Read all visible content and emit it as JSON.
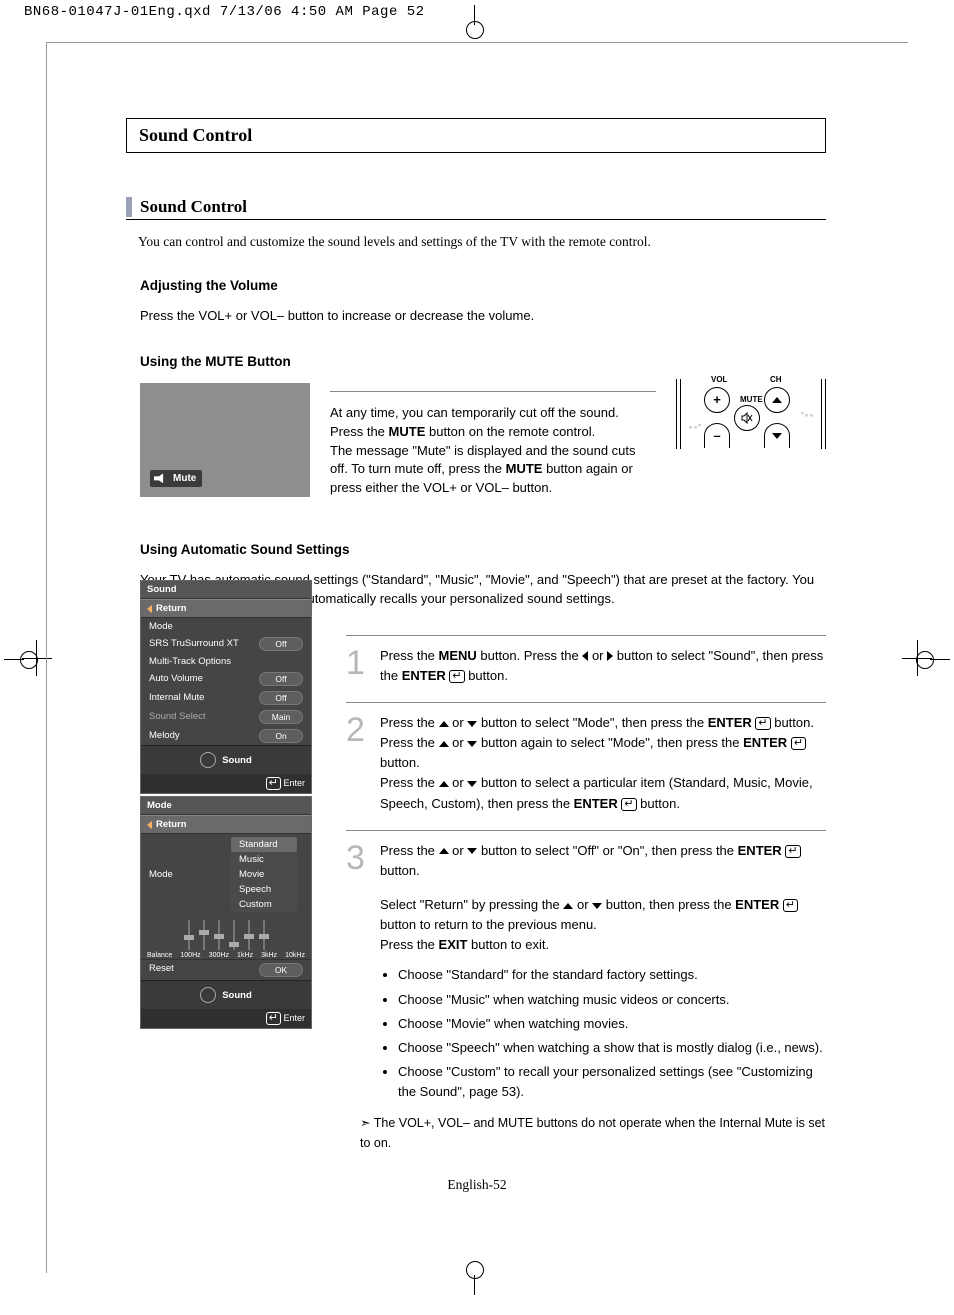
{
  "file_header": "BN68-01047J-01Eng.qxd  7/13/06  4:50 AM  Page 52",
  "chapter_title": "Sound Control",
  "section_title": "Sound Control",
  "intro": "You can control and customize the sound levels and settings of the TV with the remote control.",
  "sub1": "Adjusting the Volume",
  "sub1_body": "Press the VOL+ or VOL– button to increase or decrease the volume.",
  "sub2": "Using the MUTE Button",
  "osd_mute_label": "Mute",
  "mute_para_1": "At any time, you can temporarily cut off the sound.",
  "mute_para_2a": "Press the ",
  "mute_bold_MUTE": "MUTE",
  "mute_para_2b": " button on the remote control.",
  "mute_para_3": "The message \"Mute\" is displayed and the sound cuts off. To turn mute off, press the ",
  "mute_para_3b": " button again or press either the VOL+ or VOL– button.",
  "remote": {
    "vol": "VOL",
    "ch": "CH",
    "mute": "MUTE"
  },
  "sub3": "Using Automatic Sound Settings",
  "sub3_intro": "Your TV has automatic sound settings (\"Standard\", \"Music\", \"Movie\", and \"Speech\") that are preset at the factory. You can select \"Custom\", which automatically recalls your personalized sound settings.",
  "osd_sound": {
    "title": "Sound",
    "return": "Return",
    "rows": [
      {
        "label": "Mode",
        "value": ""
      },
      {
        "label": "SRS TruSurround XT",
        "value": "Off"
      },
      {
        "label": "Multi-Track Options",
        "value": ""
      },
      {
        "label": "Auto Volume",
        "value": "Off"
      },
      {
        "label": "Internal Mute",
        "value": "Off"
      },
      {
        "label": "Sound Select",
        "value": "Main",
        "dim": true
      },
      {
        "label": "Melody",
        "value": "On"
      }
    ],
    "footer": "Sound",
    "enter": "Enter"
  },
  "osd_mode": {
    "title": "Mode",
    "return": "Return",
    "mode_label": "Mode",
    "options": [
      "Standard",
      "Music",
      "Movie",
      "Speech",
      "Custom"
    ],
    "eq_labels": [
      "Balance",
      "100Hz",
      "300Hz",
      "1kHz",
      "3kHz",
      "10kHz"
    ],
    "reset": "Reset",
    "ok": "OK",
    "footer": "Sound",
    "enter": "Enter"
  },
  "steps": {
    "s1": {
      "num": "1",
      "a": "Press the ",
      "MENU": "MENU",
      "b": " button. Press the ",
      "c": " or ",
      "d": " button to select \"Sound\", then press the ",
      "ENTER": "ENTER",
      "e": " button."
    },
    "s2": {
      "num": "2",
      "a": "Press the ",
      "b": " or ",
      "c": " button to select \"Mode\", then press the ",
      "ENTER": "ENTER",
      "d": " button. Press the ",
      "e": " or ",
      "f": " button again to select \"Mode\", then press the ",
      "g": " button.",
      "h": "Press the ",
      "i": " or ",
      "j": " button to select a particular item (Standard, Music, Movie, Speech, Custom), then press the ",
      "k": " button."
    },
    "s3": {
      "num": "3",
      "a": "Press the ",
      "b": " or ",
      "c": " button to select \"Off\" or \"On\", then press the ",
      "ENTER": "ENTER",
      "d": " button.",
      "e": "Select \"Return\" by pressing the ",
      "f": " or ",
      "g": " button, then press the ",
      "h": " button to return to the previous menu.",
      "i": "Press the ",
      "EXIT": "EXIT",
      "j": " button to exit."
    },
    "bullets": [
      "Choose \"Standard\" for the standard factory settings.",
      "Choose \"Music\" when watching music videos or concerts.",
      "Choose \"Movie\" when watching movies.",
      "Choose \"Speech\" when watching a show that is mostly dialog (i.e., news).",
      "Choose \"Custom\" to recall your personalized settings (see \"Customizing the Sound\", page 53)."
    ],
    "note": "The VOL+, VOL– and MUTE buttons do not  operate when the Internal Mute is set to on."
  },
  "page_footer": "English-52"
}
